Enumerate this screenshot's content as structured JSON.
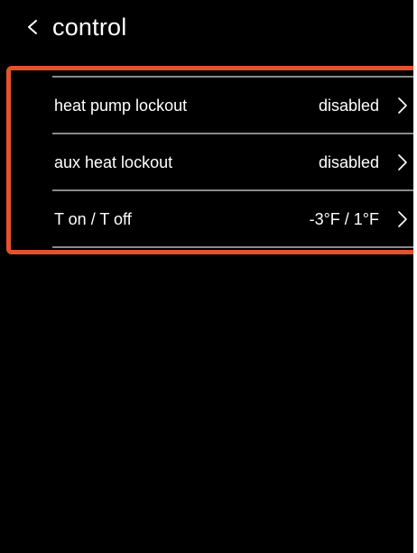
{
  "header": {
    "title": "control",
    "back_icon": "chevron-left-icon"
  },
  "settings": [
    {
      "label": "heat pump lockout",
      "value": "disabled",
      "icon": "chevron-right-icon"
    },
    {
      "label": "aux heat lockout",
      "value": "disabled",
      "icon": "chevron-right-icon"
    },
    {
      "label": "T on / T off",
      "value": "-3°F / 1°F",
      "icon": "chevron-right-icon"
    }
  ],
  "colors": {
    "background": "#000000",
    "text": "#ffffff",
    "divider": "#8a8a8a",
    "highlight": "#e8502c"
  }
}
